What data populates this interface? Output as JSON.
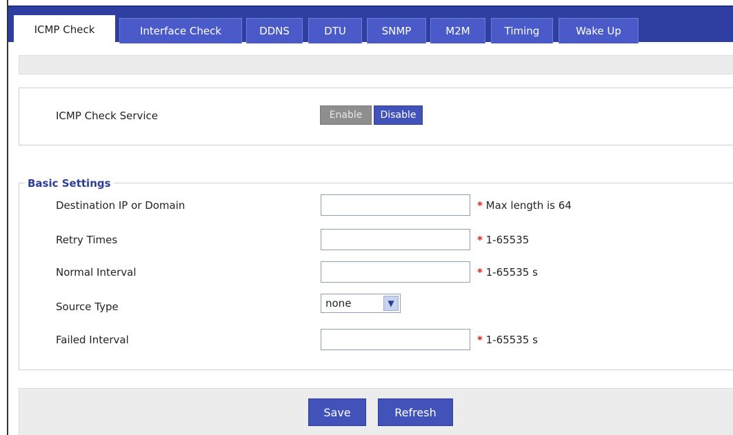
{
  "tabs": [
    {
      "label": "ICMP Check"
    },
    {
      "label": "Interface Check"
    },
    {
      "label": "DDNS"
    },
    {
      "label": "DTU"
    },
    {
      "label": "SNMP"
    },
    {
      "label": "M2M"
    },
    {
      "label": "Timing"
    },
    {
      "label": "Wake Up"
    }
  ],
  "service": {
    "label": "ICMP Check Service",
    "enable_label": "Enable",
    "disable_label": "Disable"
  },
  "basic": {
    "legend": "Basic Settings",
    "fields": [
      {
        "label": "Destination IP or Domain",
        "value": "",
        "hint": "Max length is 64"
      },
      {
        "label": "Retry Times",
        "value": "",
        "hint": "1-65535"
      },
      {
        "label": "Normal Interval",
        "value": "",
        "hint": "1-65535 s"
      },
      {
        "label": "Source Type",
        "value": "none"
      },
      {
        "label": "Failed Interval",
        "value": "",
        "hint": "1-65535 s"
      }
    ],
    "required_mark": "*"
  },
  "actions": {
    "save_label": "Save",
    "refresh_label": "Refresh"
  },
  "colors": {
    "tabbar": "#2e3fa1",
    "tab": "#4a5bc9",
    "button": "#4152b8",
    "legend": "#2c3c9a",
    "required": "#e02020"
  }
}
